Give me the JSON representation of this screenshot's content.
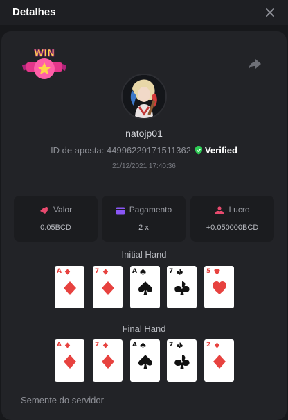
{
  "header": {
    "title": "Detalhes"
  },
  "bet": {
    "username": "natojp01",
    "id_label": "ID de aposta:",
    "id_value": "44996229171511362",
    "verified": "Verified",
    "timestamp": "21/12/2021 17:40:36",
    "badge_text": "WIN"
  },
  "stats": [
    {
      "label": "Valor",
      "value": "0.05BCD",
      "icon": "wager-icon",
      "color": "#e84a6e"
    },
    {
      "label": "Pagamento",
      "value": "2 x",
      "icon": "card-icon",
      "color": "#8a56f5"
    },
    {
      "label": "Lucro",
      "value": "+0.050000BCD",
      "icon": "profit-icon",
      "color": "#e84a6e"
    }
  ],
  "initial_hand": {
    "title": "Initial Hand",
    "cards": [
      {
        "rank": "A",
        "suit": "diamond"
      },
      {
        "rank": "7",
        "suit": "diamond"
      },
      {
        "rank": "A",
        "suit": "spade"
      },
      {
        "rank": "7",
        "suit": "club"
      },
      {
        "rank": "5",
        "suit": "heart"
      }
    ]
  },
  "final_hand": {
    "title": "Final Hand",
    "cards": [
      {
        "rank": "A",
        "suit": "diamond"
      },
      {
        "rank": "7",
        "suit": "diamond"
      },
      {
        "rank": "A",
        "suit": "spade"
      },
      {
        "rank": "7",
        "suit": "club"
      },
      {
        "rank": "2",
        "suit": "diamond"
      }
    ]
  },
  "seed": {
    "label": "Semente do servidor"
  },
  "colors": {
    "background": "#17181b",
    "panel": "#222327",
    "verified_green": "#2ecc55",
    "red_suit": "#e7423f"
  }
}
